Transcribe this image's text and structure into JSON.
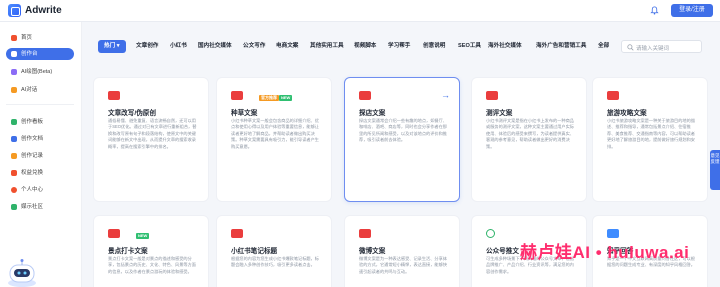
{
  "app": {
    "name": "Adwrite",
    "login_label": "登录/注册"
  },
  "sidebar": {
    "items": [
      {
        "label": "首页",
        "color": "#f0502e"
      },
      {
        "label": "创作台",
        "color": "#ffffff",
        "active": true
      },
      {
        "label": "AI绘图(Beta)",
        "color": "#8b6cf6"
      },
      {
        "label": "AI对话",
        "color": "#f59a23"
      },
      {
        "label": "创作看板",
        "color": "#2fb36a"
      },
      {
        "label": "创作文档",
        "color": "#3f6fe8"
      },
      {
        "label": "创作记录",
        "color": "#f59a23"
      },
      {
        "label": "权益兑换",
        "color": "#f0502e"
      },
      {
        "label": "个人中心",
        "color": "#f0502e"
      },
      {
        "label": "媒示社区",
        "color": "#2fb36a"
      }
    ]
  },
  "tabs": [
    "热门",
    "文章创作",
    "小红书",
    "国内社交媒体",
    "公文写作",
    "电商文案",
    "其他实用工具",
    "视频脚本",
    "学习帮手",
    "创意说明",
    "SEO工具",
    "海外社交媒体",
    "海外广告和营销工具",
    "全部"
  ],
  "search": {
    "placeholder": "请输入关键词"
  },
  "cards": [
    {
      "title": "文章改写/伪原创",
      "desc": "通俗易懂、避免重复、语言流畅自然，还可以用于SEO优化。通过对已有文章进行重新组合，替换和改写原有句子和段落结构，使原文中的关键词能够在新文中出现，从而提升文章的搜索收录概率，提高在搜索引擎中的排名。",
      "icon": "red"
    },
    {
      "title": "种草文案",
      "desc": "小红书种草文案一般会包含商品的详细介绍、优点和使用心得以及用户体验等重要信息，能够让读者更好地了解商品，并帮助读者做出购买决策。种草文案需要具有吸引力，能引导读者产生购买意愿。",
      "icon": "red",
      "badges": [
        "官方推荐",
        "NEW"
      ]
    },
    {
      "title": "探店文案",
      "desc": "探店文案通常会介绍一些有趣的地点，如餐厅、咖啡店、酒吧、商店等，同时也会分享作者在那里的所见所闻和感受，以及对该地点的评价和推荐，吸引读者前去体验。",
      "icon": "red",
      "selected": true
    },
    {
      "title": "测评文案",
      "desc": "小红书测评文案是指在小红书上发布的一种商品或服务的测评文案，这种文案主要通过用户实际使用、体验后的感受来撰写，为读者提供真实、客观的参考意见，帮助读者做出更好的消费决策。",
      "icon": "red"
    },
    {
      "title": "旅游攻略文案",
      "desc": "小红书旅游攻略文案是一种关于旅游目的地的描述、推荐和指导，通常包括景点介绍、住宿推荐、美食推荐、交通指南等内容，可以帮助读者更好地了解旅游目的地，提前做好旅行规划和安排。",
      "icon": "red"
    },
    {
      "title": "景点打卡文案",
      "desc": "景点打卡文案一般是对景点的描述和感受的分享，包括景点的历史、文化、特色、风景等方面的信息，以及作者在景点游玩的体验和感受。",
      "icon": "red",
      "badges": [
        "NEW"
      ]
    },
    {
      "title": "小红书笔记标题",
      "desc": "根据您的内容为您生成小红书爆款笔记标题，标题会融入多种创作技巧，吸引更多读者点击。",
      "icon": "red"
    },
    {
      "title": "微博文案",
      "desc": "微博文案是为一种表达感受、记录生活、分享体验的方式，它通常短小精悍，表达直接，能够快速引起读者的共鸣与互动。",
      "icon": "red"
    },
    {
      "title": "公众号推文",
      "desc": "可生成多种场景下不同风格的公众号文章，包括品牌推广、产品介绍、行业资讯等，满足您的内容创作需求。",
      "icon": "green"
    },
    {
      "title": "知乎回答",
      "desc": "知乎是一个中文互联网高质量问答社区，可以根据您的问题生成专业、有深度的知乎风格回答。",
      "icon": "blue"
    }
  ],
  "right_float": {
    "label": "意见反馈"
  },
  "watermark": "赫卢娃AI • huluwa.ai"
}
